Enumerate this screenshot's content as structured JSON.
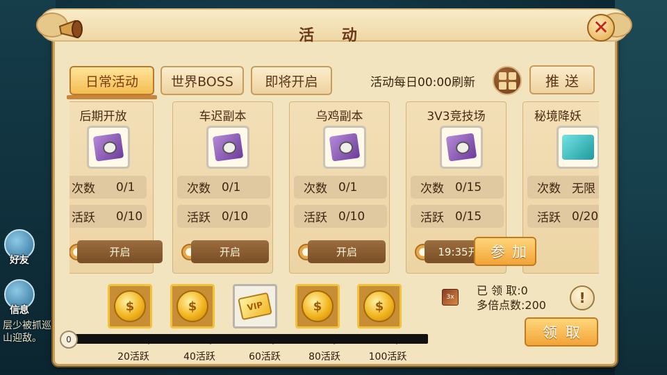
{
  "window": {
    "title": "活 动"
  },
  "tabs": [
    {
      "label": "日常活动",
      "active": true
    },
    {
      "label": "世界BOSS",
      "active": false
    },
    {
      "label": "即将开启",
      "active": false
    }
  ],
  "header": {
    "refresh_text": "活动每日00:00刷新",
    "push_label": "推送"
  },
  "cards": [
    {
      "name": "后期开放",
      "icon": "purple-scroll-icon",
      "times_label": "次数",
      "times_value": "0/1",
      "active_label": "活跃",
      "active_value": "0/10",
      "button": "开启"
    },
    {
      "name": "车迟副本",
      "icon": "purple-scroll-icon",
      "times_label": "次数",
      "times_value": "0/1",
      "active_label": "活跃",
      "active_value": "0/10",
      "button": "开启"
    },
    {
      "name": "乌鸡副本",
      "icon": "purple-scroll-icon",
      "times_label": "次数",
      "times_value": "0/1",
      "active_label": "活跃",
      "active_value": "0/10",
      "button": "开启"
    },
    {
      "name": "3V3竞技场",
      "icon": "purple-scroll-icon",
      "times_label": "次数",
      "times_value": "0/15",
      "active_label": "活跃",
      "active_value": "0/15",
      "button": "19:35开启"
    },
    {
      "name": "秘境降妖",
      "icon": "green-scroll-icon",
      "times_label": "次数",
      "times_value": "无限",
      "active_label": "活跃",
      "active_value": "0/20",
      "button": "参加"
    }
  ],
  "rewards": {
    "items": [
      {
        "type": "gold-coin",
        "milestone": "20活跃"
      },
      {
        "type": "gold-coin",
        "milestone": "40活跃"
      },
      {
        "type": "vip-card",
        "milestone": "60活跃",
        "badge": "VIP"
      },
      {
        "type": "gold-coin",
        "milestone": "80活跃"
      },
      {
        "type": "gold-coin",
        "milestone": "100活跃"
      }
    ],
    "progress_start": "0",
    "progress_fraction": 0
  },
  "claim": {
    "claimed_label": "已 领 取",
    "claimed_value": "0",
    "multiplier_label": "多倍点数",
    "multiplier_value": "200",
    "button": "领取",
    "hint": "!"
  },
  "sidebar": {
    "friends": "好友",
    "messages": "信息"
  },
  "chat": {
    "text": "层少被抓巡山迎敌。"
  },
  "colors": {
    "accent": "#f2a437",
    "panel": "#f3e4c0",
    "title": "#6b3a1a"
  }
}
